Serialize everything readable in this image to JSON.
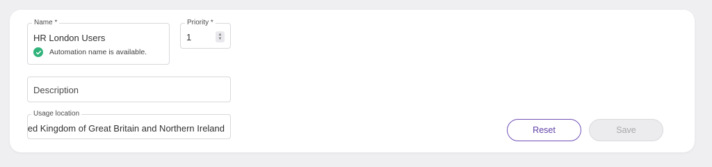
{
  "form": {
    "name": {
      "label": "Name *",
      "value": "HR London Users",
      "helper": "Automation name is available."
    },
    "priority": {
      "label": "Priority *",
      "value": "1"
    },
    "description": {
      "placeholder": "Description"
    },
    "usage_location": {
      "label": "Usage location",
      "value": "United Kingdom of Great Britain and Northern Ireland"
    }
  },
  "actions": {
    "reset_label": "Reset",
    "save_label": "Save"
  },
  "colors": {
    "accent": "#6f4fb4",
    "success": "#2fb37a",
    "disabled": "#ececee"
  }
}
